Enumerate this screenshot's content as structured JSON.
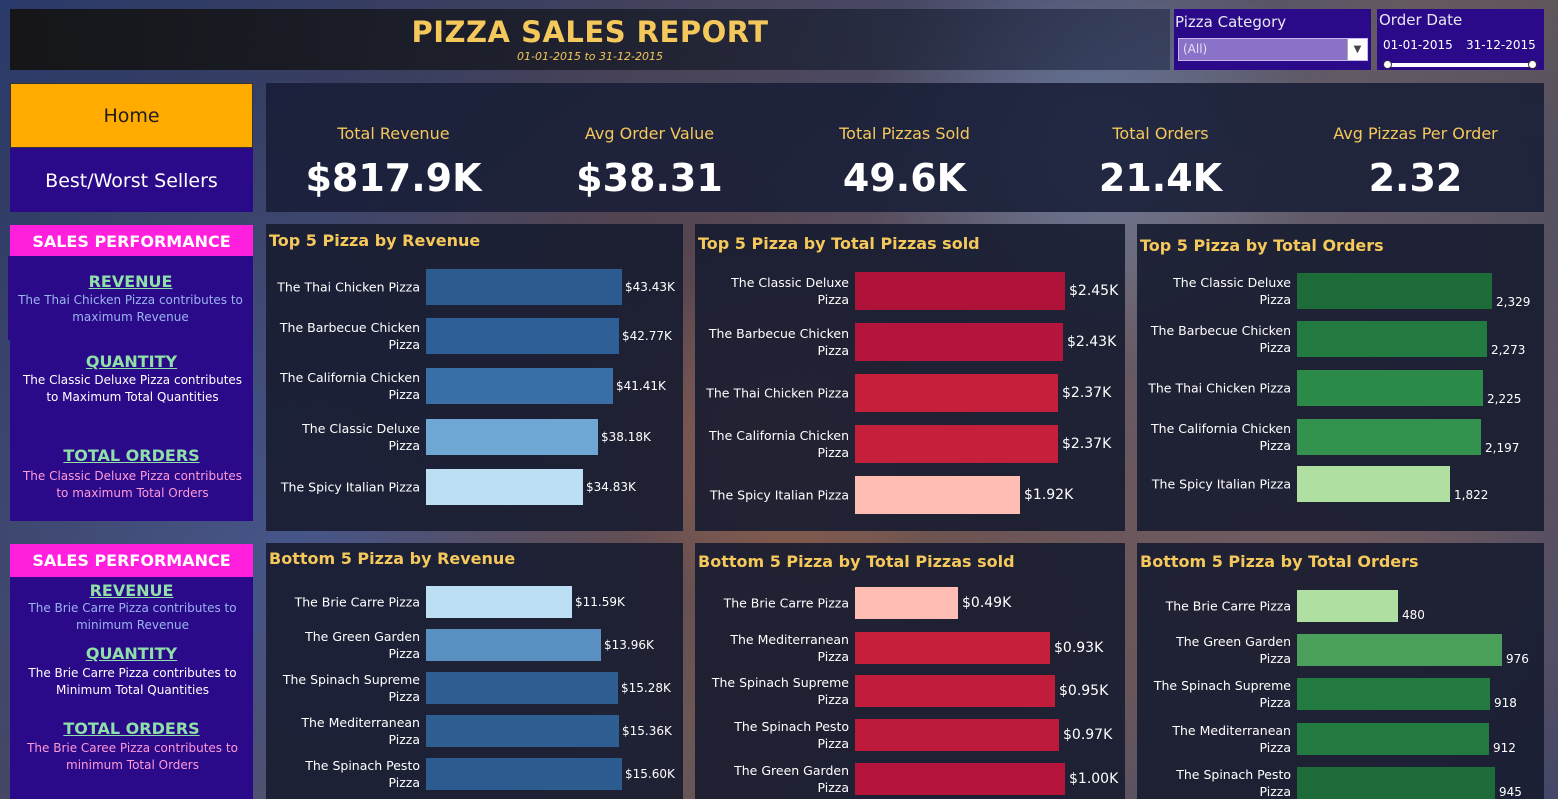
{
  "header": {
    "title": "PIZZA SALES REPORT",
    "subtitle": "01-01-2015 to 31-12-2015"
  },
  "filters": {
    "category_label": "Pizza Category",
    "category_value": "(All)",
    "date_label": "Order Date",
    "date_from": "01-01-2015",
    "date_to": "31-12-2015"
  },
  "nav": {
    "home": "Home",
    "best_worst": "Best/Worst Sellers"
  },
  "kpis": [
    {
      "label": "Total Revenue",
      "value": "$817.9K"
    },
    {
      "label": "Avg Order Value",
      "value": "$38.31"
    },
    {
      "label": "Total Pizzas Sold",
      "value": "49.6K"
    },
    {
      "label": "Total Orders",
      "value": "21.4K"
    },
    {
      "label": "Avg Pizzas Per Order",
      "value": "2.32"
    }
  ],
  "sales_top": {
    "heading": "SALES PERFORMANCE",
    "items": [
      {
        "title": "REVENUE",
        "desc": "The Thai Chicken Pizza contributes to maximum Revenue"
      },
      {
        "title": "QUANTITY",
        "desc": "The Classic Deluxe Pizza contributes to Maximum Total Quantities"
      },
      {
        "title": "TOTAL ORDERS",
        "desc": "The Classic Deluxe Pizza contributes to maximum Total Orders"
      }
    ]
  },
  "sales_bottom": {
    "heading": "SALES PERFORMANCE",
    "items": [
      {
        "title": "REVENUE",
        "desc": "The Brie Carre Pizza contributes to minimum Revenue"
      },
      {
        "title": "QUANTITY",
        "desc": "The Brie Carre Pizza contributes to Minimum Total Quantities"
      },
      {
        "title": "TOTAL ORDERS",
        "desc": "The Brie Caree Pizza contributes to minimum Total Orders"
      }
    ]
  },
  "colors": {
    "accent": "#f5c85b",
    "nav_active": "#ffab00",
    "nav_bg": "#2b0a8a",
    "sales_heading": "#ff1fdd"
  },
  "chart_data": [
    {
      "type": "bar",
      "orientation": "horizontal",
      "title": "Top 5 Pizza by Revenue",
      "categories": [
        "The Thai Chicken Pizza",
        "The Barbecue Chicken Pizza",
        "The California Chicken Pizza",
        "The Classic Deluxe Pizza",
        "The Spicy Italian Pizza"
      ],
      "values": [
        43.43,
        42.77,
        41.41,
        38.18,
        34.83
      ],
      "labels": [
        "$43.43K",
        "$42.77K",
        "$41.41K",
        "$38.18K",
        "$34.83K"
      ],
      "colors": [
        "#2c5c8f",
        "#2e6097",
        "#3a6ea6",
        "#6ea6d4",
        "#bcdff3"
      ]
    },
    {
      "type": "bar",
      "orientation": "horizontal",
      "title": "Top 5 Pizza by Total Pizzas sold",
      "categories": [
        "The Classic Deluxe Pizza",
        "The Barbecue Chicken Pizza",
        "The Thai Chicken Pizza",
        "The California Chicken Pizza",
        "The Spicy Italian Pizza"
      ],
      "values": [
        2.45,
        2.43,
        2.37,
        2.37,
        1.92
      ],
      "labels": [
        "$2.45K",
        "$2.43K",
        "$2.37K",
        "$2.37K",
        "$1.92K"
      ],
      "colors": [
        "#b0133a",
        "#b5153c",
        "#c51f3b",
        "#c51f3b",
        "#ffbdb4"
      ]
    },
    {
      "type": "bar",
      "orientation": "horizontal",
      "title": "Top 5 Pizza by Total Orders",
      "categories": [
        "The Classic Deluxe Pizza",
        "The Barbecue Chicken Pizza",
        "The Thai Chicken Pizza",
        "The California Chicken Pizza",
        "The Spicy Italian Pizza"
      ],
      "values": [
        2329,
        2273,
        2225,
        2197,
        1822
      ],
      "labels": [
        "2,329",
        "2,273",
        "2,225",
        "2,197",
        "1,822"
      ],
      "colors": [
        "#1e6b3a",
        "#227a40",
        "#2b8a48",
        "#33924d",
        "#afe0a2"
      ]
    },
    {
      "type": "bar",
      "orientation": "horizontal",
      "title": "Bottom 5 Pizza by Revenue",
      "categories": [
        "The Brie Carre Pizza",
        "The Green Garden Pizza",
        "The Spinach Supreme Pizza",
        "The Mediterranean Pizza",
        "The Spinach Pesto Pizza"
      ],
      "values": [
        11.59,
        13.96,
        15.28,
        15.36,
        15.6
      ],
      "labels": [
        "$11.59K",
        "$13.96K",
        "$15.28K",
        "$15.36K",
        "$15.60K"
      ],
      "colors": [
        "#bcdff3",
        "#5a8fc2",
        "#2e5e92",
        "#2e5e92",
        "#2c5c8f"
      ]
    },
    {
      "type": "bar",
      "orientation": "horizontal",
      "title": "Bottom 5 Pizza by Total Pizzas sold",
      "categories": [
        "The Brie Carre Pizza",
        "The Mediterranean Pizza",
        "The Spinach Supreme Pizza",
        "The Spinach Pesto Pizza",
        "The Green Garden Pizza"
      ],
      "values": [
        0.49,
        0.93,
        0.95,
        0.97,
        1.0
      ],
      "labels": [
        "$0.49K",
        "$0.93K",
        "$0.95K",
        "$0.97K",
        "$1.00K"
      ],
      "colors": [
        "#ffbdb4",
        "#c51f3b",
        "#c21c3b",
        "#bd193b",
        "#b5153c"
      ]
    },
    {
      "type": "bar",
      "orientation": "horizontal",
      "title": "Bottom 5 Pizza by Total Orders",
      "categories": [
        "The Brie Carre Pizza",
        "The Green Garden Pizza",
        "The Spinach Supreme Pizza",
        "The Mediterranean Pizza",
        "The Spinach Pesto Pizza"
      ],
      "values": [
        480,
        976,
        918,
        912,
        945
      ],
      "labels": [
        "480",
        "976",
        "918",
        "912",
        "945"
      ],
      "colors": [
        "#afe0a2",
        "#4aa05a",
        "#227a40",
        "#227a40",
        "#1e6b3a"
      ]
    }
  ]
}
